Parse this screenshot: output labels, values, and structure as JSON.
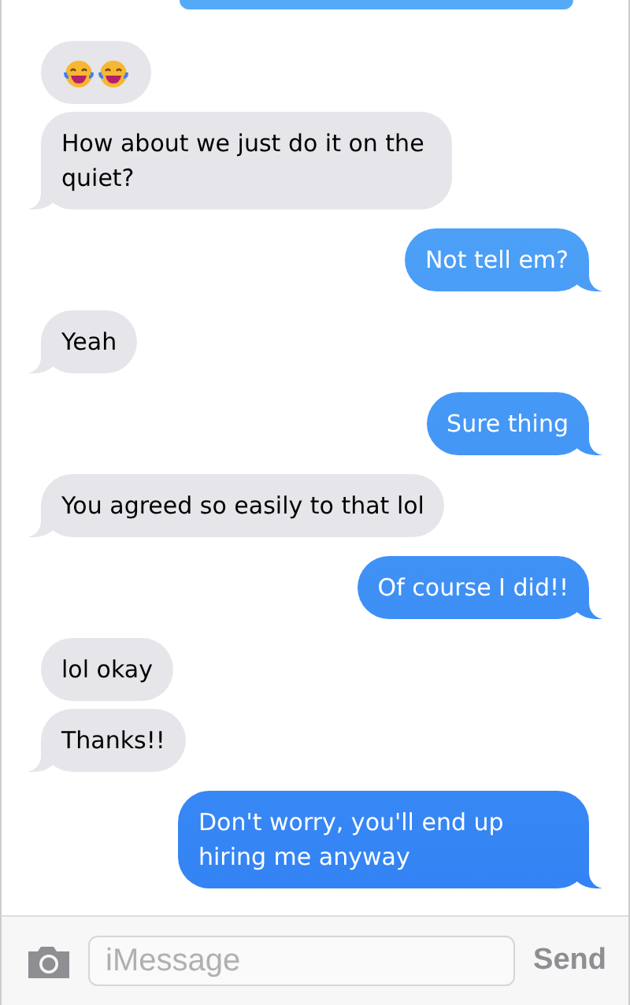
{
  "messages": [
    {
      "outgoing": true,
      "kind": "cut-off"
    },
    {
      "outgoing": false,
      "kind": "laugh-emojis",
      "tail": false
    },
    {
      "outgoing": false,
      "kind": "text",
      "text": "How about we just do it on the quiet?",
      "tail": true
    },
    {
      "outgoing": true,
      "kind": "text",
      "text": "Not tell em?",
      "tail": true
    },
    {
      "outgoing": false,
      "kind": "text",
      "text": "Yeah",
      "tail": true
    },
    {
      "outgoing": true,
      "kind": "text",
      "text": "Sure thing",
      "tail": true
    },
    {
      "outgoing": false,
      "kind": "text",
      "text": "You agreed so easily to that lol",
      "tail": true
    },
    {
      "outgoing": true,
      "kind": "text",
      "text": "Of course I did!!",
      "tail": true
    },
    {
      "outgoing": false,
      "kind": "text",
      "text": "lol okay",
      "tail": false
    },
    {
      "outgoing": false,
      "kind": "text",
      "text": "Thanks!!",
      "tail": true
    },
    {
      "outgoing": true,
      "kind": "text",
      "text": "Don't worry, you'll end up hiring me anyway",
      "tail": true
    }
  ],
  "composer": {
    "placeholder": "iMessage",
    "send": "Send"
  }
}
